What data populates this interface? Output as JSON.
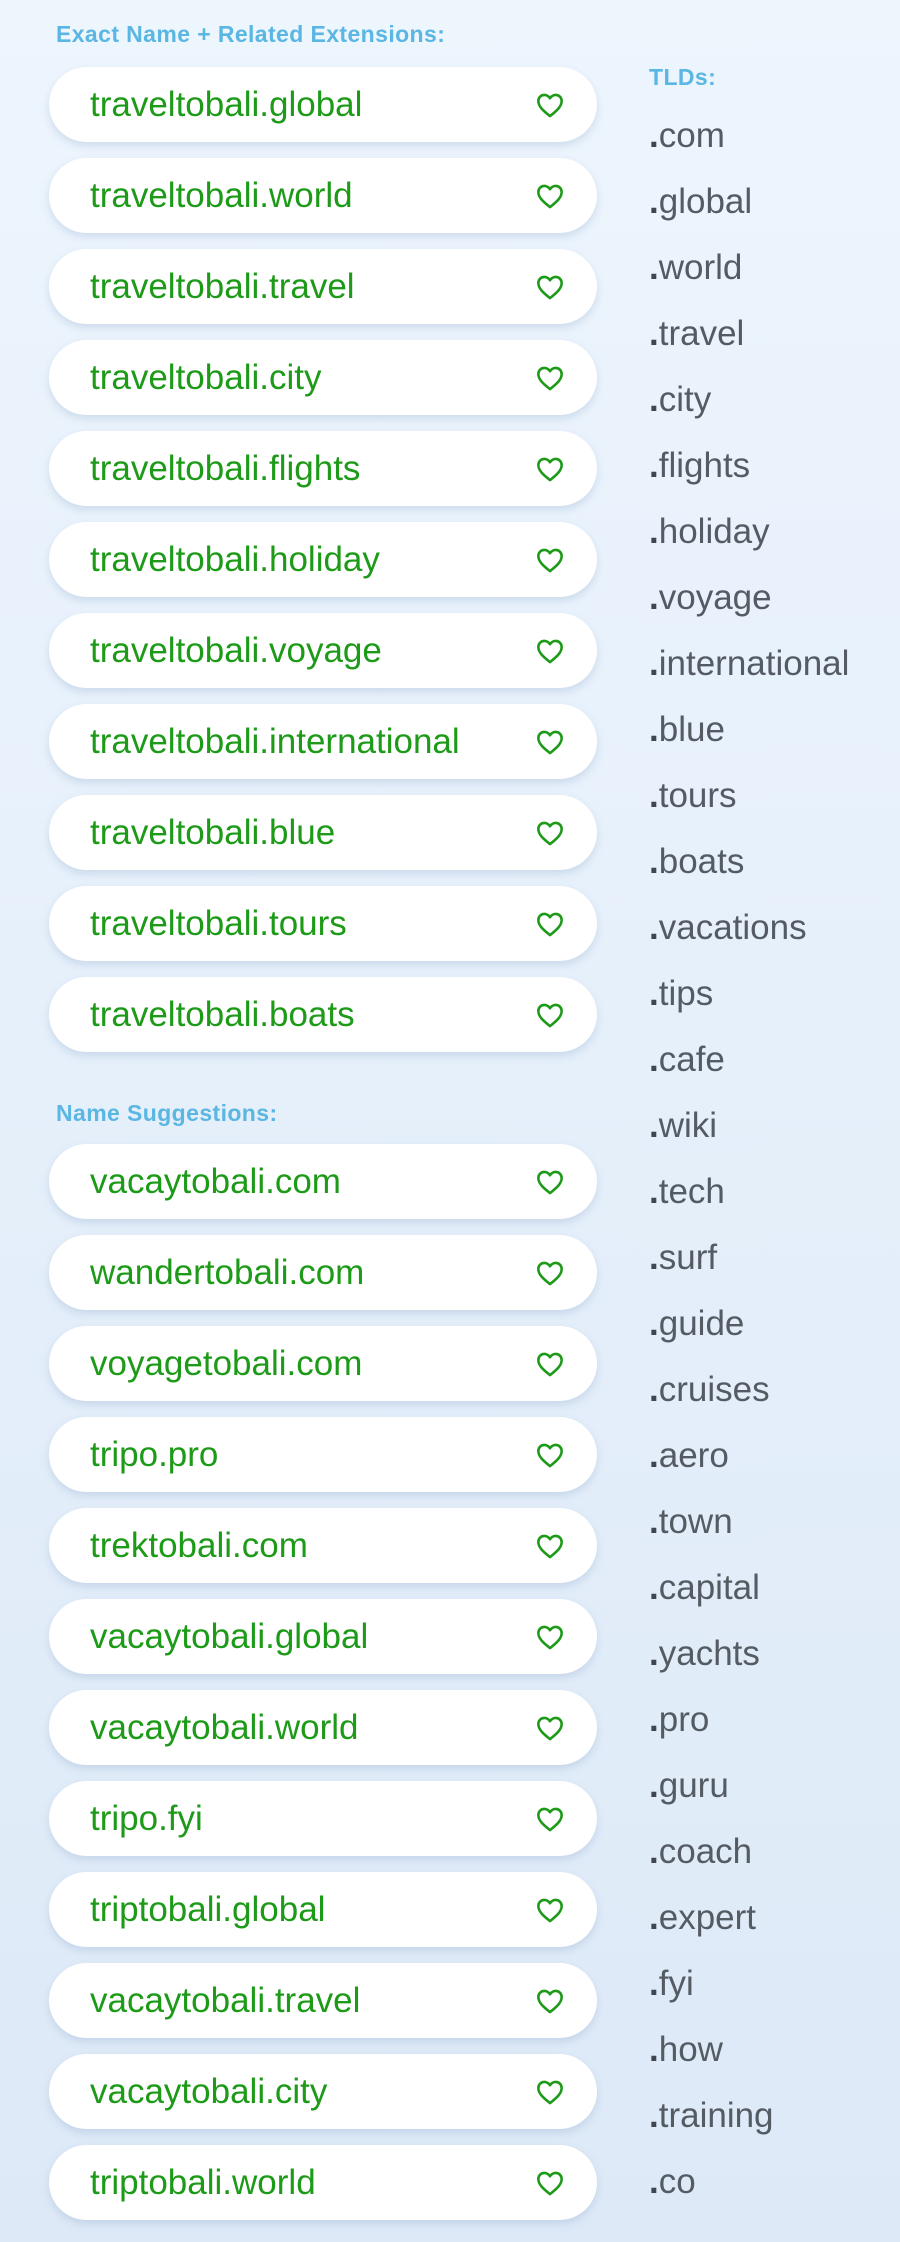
{
  "sections": {
    "exact_label": "Exact Name + Related Extensions:",
    "names_label": "Name Suggestions:",
    "tld_label": "TLDs:"
  },
  "colors": {
    "domain_text": "#1d9a18",
    "heart": "#1d9a18",
    "section_label": "#5ab6e2",
    "tld_text": "#555b63"
  },
  "exact_domains": [
    {
      "name": "traveltobali.global",
      "icon": "heart-outline-icon"
    },
    {
      "name": "traveltobali.world",
      "icon": "heart-outline-icon"
    },
    {
      "name": "traveltobali.travel",
      "icon": "heart-outline-icon"
    },
    {
      "name": "traveltobali.city",
      "icon": "heart-outline-icon"
    },
    {
      "name": "traveltobali.flights",
      "icon": "heart-outline-icon"
    },
    {
      "name": "traveltobali.holiday",
      "icon": "heart-outline-icon"
    },
    {
      "name": "traveltobali.voyage",
      "icon": "heart-outline-icon"
    },
    {
      "name": "traveltobali.international",
      "icon": "heart-outline-icon"
    },
    {
      "name": "traveltobali.blue",
      "icon": "heart-outline-icon"
    },
    {
      "name": "traveltobali.tours",
      "icon": "heart-outline-icon"
    },
    {
      "name": "traveltobali.boats",
      "icon": "heart-outline-icon"
    }
  ],
  "name_suggestions": [
    {
      "name": "vacaytobali.com",
      "icon": "heart-outline-icon"
    },
    {
      "name": "wandertobali.com",
      "icon": "heart-outline-icon"
    },
    {
      "name": "voyagetobali.com",
      "icon": "heart-outline-icon"
    },
    {
      "name": "tripo.pro",
      "icon": "heart-outline-icon"
    },
    {
      "name": "trektobali.com",
      "icon": "heart-outline-icon"
    },
    {
      "name": "vacaytobali.global",
      "icon": "heart-outline-icon"
    },
    {
      "name": "vacaytobali.world",
      "icon": "heart-outline-icon"
    },
    {
      "name": "tripo.fyi",
      "icon": "heart-outline-icon"
    },
    {
      "name": "triptobali.global",
      "icon": "heart-outline-icon"
    },
    {
      "name": "vacaytobali.travel",
      "icon": "heart-outline-icon"
    },
    {
      "name": "vacaytobali.city",
      "icon": "heart-outline-icon"
    },
    {
      "name": "triptobali.world",
      "icon": "heart-outline-icon"
    }
  ],
  "tlds": [
    {
      "dot": ".",
      "ext": "com"
    },
    {
      "dot": ".",
      "ext": "global"
    },
    {
      "dot": ".",
      "ext": "world"
    },
    {
      "dot": ".",
      "ext": "travel"
    },
    {
      "dot": ".",
      "ext": "city"
    },
    {
      "dot": ".",
      "ext": "flights"
    },
    {
      "dot": ".",
      "ext": "holiday"
    },
    {
      "dot": ".",
      "ext": "voyage"
    },
    {
      "dot": ".",
      "ext": "international"
    },
    {
      "dot": ".",
      "ext": "blue"
    },
    {
      "dot": ".",
      "ext": "tours"
    },
    {
      "dot": ".",
      "ext": "boats"
    },
    {
      "dot": ".",
      "ext": "vacations"
    },
    {
      "dot": ".",
      "ext": "tips"
    },
    {
      "dot": ".",
      "ext": "cafe"
    },
    {
      "dot": ".",
      "ext": "wiki"
    },
    {
      "dot": ".",
      "ext": "tech"
    },
    {
      "dot": ".",
      "ext": "surf"
    },
    {
      "dot": ".",
      "ext": "guide"
    },
    {
      "dot": ".",
      "ext": "cruises"
    },
    {
      "dot": ".",
      "ext": "aero"
    },
    {
      "dot": ".",
      "ext": "town"
    },
    {
      "dot": ".",
      "ext": "capital"
    },
    {
      "dot": ".",
      "ext": "yachts"
    },
    {
      "dot": ".",
      "ext": "pro"
    },
    {
      "dot": ".",
      "ext": "guru"
    },
    {
      "dot": ".",
      "ext": "coach"
    },
    {
      "dot": ".",
      "ext": "expert"
    },
    {
      "dot": ".",
      "ext": "fyi"
    },
    {
      "dot": ".",
      "ext": "how"
    },
    {
      "dot": ".",
      "ext": "training"
    },
    {
      "dot": ".",
      "ext": "co"
    }
  ]
}
